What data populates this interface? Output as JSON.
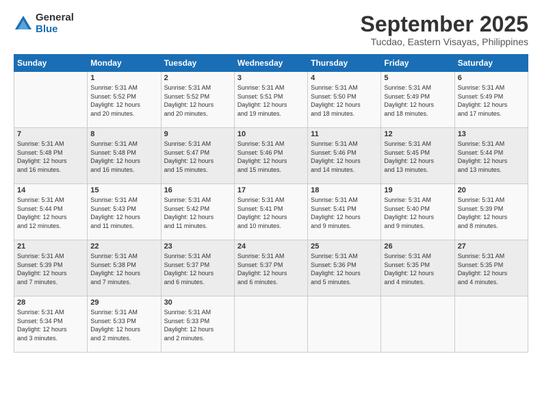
{
  "header": {
    "logo_general": "General",
    "logo_blue": "Blue",
    "title": "September 2025",
    "subtitle": "Tucdao, Eastern Visayas, Philippines"
  },
  "weekdays": [
    "Sunday",
    "Monday",
    "Tuesday",
    "Wednesday",
    "Thursday",
    "Friday",
    "Saturday"
  ],
  "weeks": [
    [
      {
        "day": "",
        "info": ""
      },
      {
        "day": "1",
        "info": "Sunrise: 5:31 AM\nSunset: 5:52 PM\nDaylight: 12 hours\nand 20 minutes."
      },
      {
        "day": "2",
        "info": "Sunrise: 5:31 AM\nSunset: 5:52 PM\nDaylight: 12 hours\nand 20 minutes."
      },
      {
        "day": "3",
        "info": "Sunrise: 5:31 AM\nSunset: 5:51 PM\nDaylight: 12 hours\nand 19 minutes."
      },
      {
        "day": "4",
        "info": "Sunrise: 5:31 AM\nSunset: 5:50 PM\nDaylight: 12 hours\nand 18 minutes."
      },
      {
        "day": "5",
        "info": "Sunrise: 5:31 AM\nSunset: 5:49 PM\nDaylight: 12 hours\nand 18 minutes."
      },
      {
        "day": "6",
        "info": "Sunrise: 5:31 AM\nSunset: 5:49 PM\nDaylight: 12 hours\nand 17 minutes."
      }
    ],
    [
      {
        "day": "7",
        "info": "Sunrise: 5:31 AM\nSunset: 5:48 PM\nDaylight: 12 hours\nand 16 minutes."
      },
      {
        "day": "8",
        "info": "Sunrise: 5:31 AM\nSunset: 5:48 PM\nDaylight: 12 hours\nand 16 minutes."
      },
      {
        "day": "9",
        "info": "Sunrise: 5:31 AM\nSunset: 5:47 PM\nDaylight: 12 hours\nand 15 minutes."
      },
      {
        "day": "10",
        "info": "Sunrise: 5:31 AM\nSunset: 5:46 PM\nDaylight: 12 hours\nand 15 minutes."
      },
      {
        "day": "11",
        "info": "Sunrise: 5:31 AM\nSunset: 5:46 PM\nDaylight: 12 hours\nand 14 minutes."
      },
      {
        "day": "12",
        "info": "Sunrise: 5:31 AM\nSunset: 5:45 PM\nDaylight: 12 hours\nand 13 minutes."
      },
      {
        "day": "13",
        "info": "Sunrise: 5:31 AM\nSunset: 5:44 PM\nDaylight: 12 hours\nand 13 minutes."
      }
    ],
    [
      {
        "day": "14",
        "info": "Sunrise: 5:31 AM\nSunset: 5:44 PM\nDaylight: 12 hours\nand 12 minutes."
      },
      {
        "day": "15",
        "info": "Sunrise: 5:31 AM\nSunset: 5:43 PM\nDaylight: 12 hours\nand 11 minutes."
      },
      {
        "day": "16",
        "info": "Sunrise: 5:31 AM\nSunset: 5:42 PM\nDaylight: 12 hours\nand 11 minutes."
      },
      {
        "day": "17",
        "info": "Sunrise: 5:31 AM\nSunset: 5:41 PM\nDaylight: 12 hours\nand 10 minutes."
      },
      {
        "day": "18",
        "info": "Sunrise: 5:31 AM\nSunset: 5:41 PM\nDaylight: 12 hours\nand 9 minutes."
      },
      {
        "day": "19",
        "info": "Sunrise: 5:31 AM\nSunset: 5:40 PM\nDaylight: 12 hours\nand 9 minutes."
      },
      {
        "day": "20",
        "info": "Sunrise: 5:31 AM\nSunset: 5:39 PM\nDaylight: 12 hours\nand 8 minutes."
      }
    ],
    [
      {
        "day": "21",
        "info": "Sunrise: 5:31 AM\nSunset: 5:39 PM\nDaylight: 12 hours\nand 7 minutes."
      },
      {
        "day": "22",
        "info": "Sunrise: 5:31 AM\nSunset: 5:38 PM\nDaylight: 12 hours\nand 7 minutes."
      },
      {
        "day": "23",
        "info": "Sunrise: 5:31 AM\nSunset: 5:37 PM\nDaylight: 12 hours\nand 6 minutes."
      },
      {
        "day": "24",
        "info": "Sunrise: 5:31 AM\nSunset: 5:37 PM\nDaylight: 12 hours\nand 6 minutes."
      },
      {
        "day": "25",
        "info": "Sunrise: 5:31 AM\nSunset: 5:36 PM\nDaylight: 12 hours\nand 5 minutes."
      },
      {
        "day": "26",
        "info": "Sunrise: 5:31 AM\nSunset: 5:35 PM\nDaylight: 12 hours\nand 4 minutes."
      },
      {
        "day": "27",
        "info": "Sunrise: 5:31 AM\nSunset: 5:35 PM\nDaylight: 12 hours\nand 4 minutes."
      }
    ],
    [
      {
        "day": "28",
        "info": "Sunrise: 5:31 AM\nSunset: 5:34 PM\nDaylight: 12 hours\nand 3 minutes."
      },
      {
        "day": "29",
        "info": "Sunrise: 5:31 AM\nSunset: 5:33 PM\nDaylight: 12 hours\nand 2 minutes."
      },
      {
        "day": "30",
        "info": "Sunrise: 5:31 AM\nSunset: 5:33 PM\nDaylight: 12 hours\nand 2 minutes."
      },
      {
        "day": "",
        "info": ""
      },
      {
        "day": "",
        "info": ""
      },
      {
        "day": "",
        "info": ""
      },
      {
        "day": "",
        "info": ""
      }
    ]
  ]
}
